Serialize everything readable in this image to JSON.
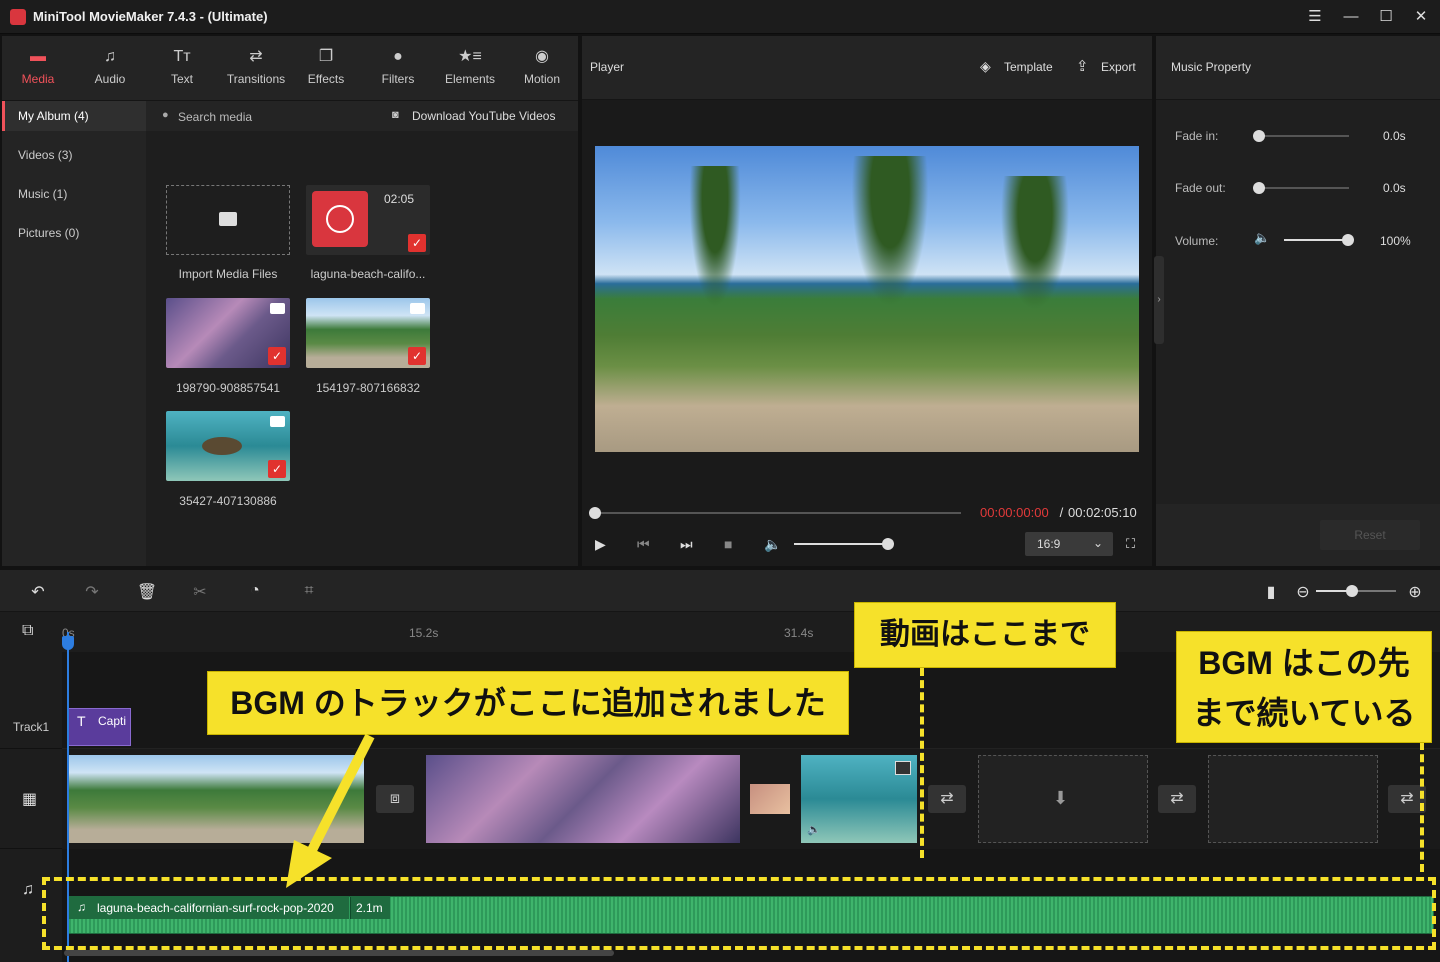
{
  "app": {
    "title": "MiniTool MovieMaker 7.4.3 - (Ultimate)"
  },
  "toolbar": [
    {
      "label": "Media",
      "icon": "folder-icon"
    },
    {
      "label": "Audio",
      "icon": "music-note-icon"
    },
    {
      "label": "Text",
      "icon": "text-icon"
    },
    {
      "label": "Transitions",
      "icon": "transitions-icon"
    },
    {
      "label": "Effects",
      "icon": "effects-icon"
    },
    {
      "label": "Filters",
      "icon": "filters-icon"
    },
    {
      "label": "Elements",
      "icon": "elements-icon"
    },
    {
      "label": "Motion",
      "icon": "motion-icon"
    }
  ],
  "sidebar": [
    {
      "label": "My Album (4)"
    },
    {
      "label": "Videos (3)"
    },
    {
      "label": "Music (1)"
    },
    {
      "label": "Pictures (0)"
    }
  ],
  "media": {
    "search_placeholder": "Search media",
    "download_label": "Download YouTube Videos",
    "items": [
      {
        "label": "Import Media Files"
      },
      {
        "label": "laguna-beach-califo...",
        "duration": "02:05"
      },
      {
        "label": "198790-908857541"
      },
      {
        "label": "154197-807166832"
      },
      {
        "label": "35427-407130886"
      }
    ]
  },
  "player": {
    "title": "Player",
    "template_label": "Template",
    "export_label": "Export",
    "current_time": "00:00:00:00",
    "separator": " / ",
    "total_time": "00:02:05:10",
    "aspect": "16:9",
    "progress": 0,
    "volume": 1
  },
  "music_property": {
    "title": "Music Property",
    "fade_in_label": "Fade in:",
    "fade_in_value": "0.0s",
    "fade_out_label": "Fade out:",
    "fade_out_value": "0.0s",
    "volume_label": "Volume:",
    "volume_value": "100%",
    "reset_label": "Reset"
  },
  "timeline": {
    "ruler": [
      "0s",
      "15.2s",
      "31.4s"
    ],
    "track1_label": "Track1",
    "caption_label": "Capti",
    "audio_clip_name": "laguna-beach-californian-surf-rock-pop-2020",
    "audio_clip_duration": "2.1m"
  },
  "annotations": {
    "video_end": "動画はここまで",
    "bgm_added": "BGM のトラックがここに追加されました",
    "bgm_continues_1": "BGM はこの先",
    "bgm_continues_2": "まで続いている"
  },
  "colors": {
    "accent": "#f0525a",
    "callout": "#f6e12a",
    "audio_track": "#2e9a5a",
    "caption": "#5a3c9c"
  }
}
